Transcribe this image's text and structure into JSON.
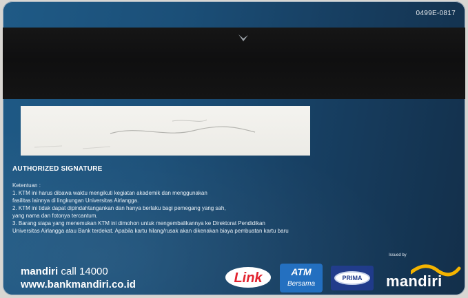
{
  "card": {
    "card_code": "0499E-0817",
    "signature_label": "AUTHORIZED SIGNATURE",
    "terms_heading": "Ketentuan :",
    "terms": [
      "1. KTM ini harus dibawa waktu mengikuti kegiatan akademik dan menggunakan",
      "    fasilitas lainnya di lingkungan Universitas Airlangga.",
      "2. KTM ini tidak dapat dipindahtangankan dan hanya berlaku bagi pemegang yang sah,",
      "    yang nama dan fotonya tercantum.",
      "3. Barang siapa yang menemukan KTM ini dimohon untuk mengembalikannya ke Direktorat Pendidikan",
      "    Universitas Airlangga atau Bank terdekat. Apabila kartu hilang/rusak akan dikenakan biaya pembuatan kartu baru"
    ],
    "issued_by": "Issued by",
    "bank_brand": "mandiri",
    "bank_call": "call 14000",
    "bank_url": "www.bankmandiri.co.id",
    "logos": {
      "link": "Link",
      "atm_top": "ATM",
      "atm_bottom": "Bersama",
      "prima": "PRIMA",
      "mandiri": "mandiri"
    }
  },
  "colors": {
    "card_blue": "#1b4f78",
    "stripe_black": "#111111",
    "link_red": "#e11d2a",
    "atm_blue": "#1f6dbf",
    "prima_navy": "#1f3a8a",
    "mandiri_gold": "#f4b400"
  },
  "icons": {
    "magnetic_mark": "arrow-mark-icon",
    "link_logo": "link-network-logo",
    "atm_logo": "atm-bersama-logo",
    "prima_logo": "prima-network-logo",
    "mandiri_logo": "mandiri-wave-logo"
  }
}
